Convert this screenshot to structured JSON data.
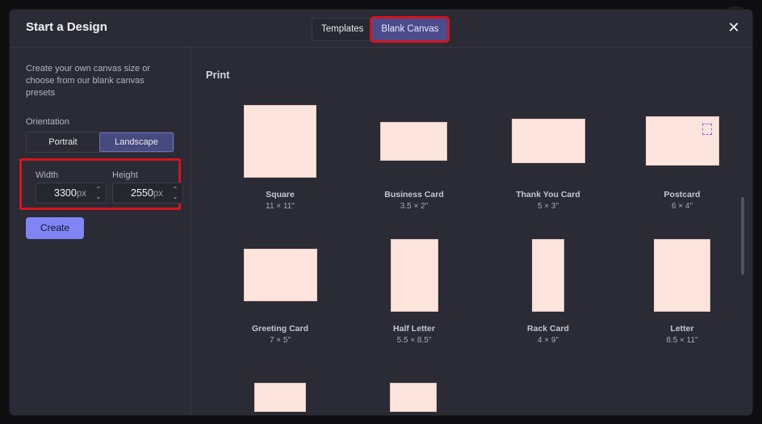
{
  "modal": {
    "title": "Start a Design",
    "tabs": [
      {
        "label": "Templates",
        "active": false
      },
      {
        "label": "Blank Canvas",
        "active": true
      }
    ],
    "close_icon": "close-icon"
  },
  "left": {
    "description": "Create your own canvas size or choose from our blank canvas presets",
    "orientation_label": "Orientation",
    "orientations": [
      "Portrait",
      "Landscape"
    ],
    "selected_orientation": "Landscape",
    "width_label": "Width",
    "height_label": "Height",
    "width_value": "3300",
    "height_value": "2550",
    "unit": "px",
    "stepper_up": "⌃",
    "stepper_down": "⌄",
    "create_label": "Create"
  },
  "print": {
    "section_title": "Print",
    "presets": [
      {
        "name": "Square",
        "size": "11 × 11\""
      },
      {
        "name": "Business Card",
        "size": "3.5 × 2\""
      },
      {
        "name": "Thank You Card",
        "size": "5 × 3\""
      },
      {
        "name": "Postcard",
        "size": "6 × 4\""
      },
      {
        "name": "Greeting Card",
        "size": "7 × 5\""
      },
      {
        "name": "Half Letter",
        "size": "5.5 × 8.5\""
      },
      {
        "name": "Rack Card",
        "size": "4 × 9\""
      },
      {
        "name": "Letter",
        "size": "8.5 × 11\""
      }
    ]
  },
  "colors": {
    "accent": "#7f86f4",
    "highlight_outline": "#d3141f",
    "thumbnail": "#fde4dd",
    "panel": "#2a2b34"
  }
}
